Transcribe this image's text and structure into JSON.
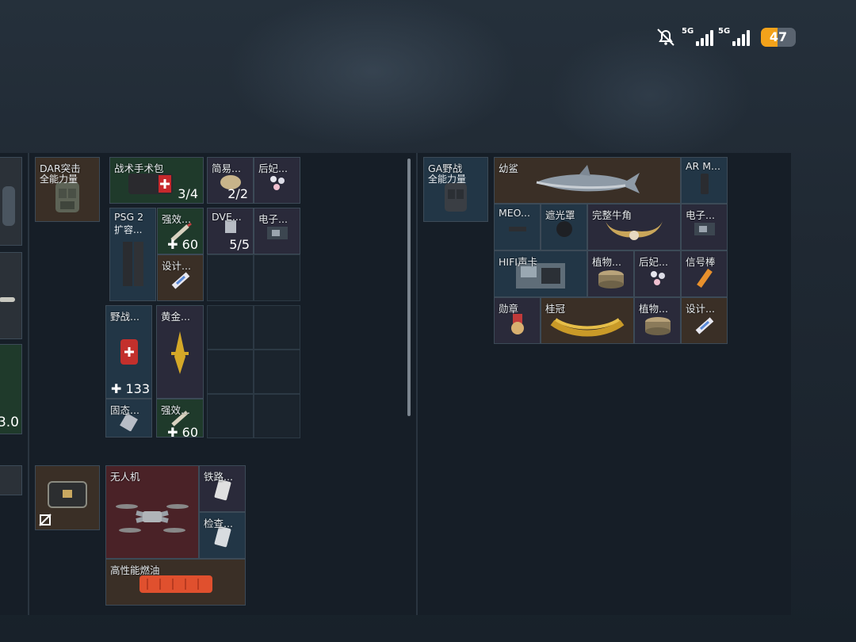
{
  "status_bar": {
    "network_1": "5G",
    "network_2": "5G",
    "battery": "47",
    "battery_level": 0.47
  },
  "left_edge": {
    "value_text": "3.0"
  },
  "backpack": {
    "armor_rig": {
      "name": "DAR突击",
      "sub": "全能力量"
    },
    "items": [
      {
        "id": "surgery_kit",
        "name": "战术手术包",
        "count": "3/4"
      },
      {
        "id": "simple_item",
        "name": "简易...",
        "count": "2/2"
      },
      {
        "id": "queen_1",
        "name": "后妃..."
      },
      {
        "id": "psg2",
        "name": "PSG 2",
        "sub": "扩容..."
      },
      {
        "id": "strong_1",
        "name": "强效...",
        "count": "60"
      },
      {
        "id": "dve",
        "name": "DVE...",
        "count": "5/5"
      },
      {
        "id": "electronic_1",
        "name": "电子..."
      },
      {
        "id": "design_1",
        "name": "设计..."
      },
      {
        "id": "field_kit",
        "name": "野战...",
        "count": "133"
      },
      {
        "id": "gold_item",
        "name": "黄金..."
      },
      {
        "id": "solid",
        "name": "固态..."
      },
      {
        "id": "strong_2",
        "name": "强效...",
        "count": "60"
      }
    ]
  },
  "secure": {
    "items": [
      {
        "id": "drone",
        "name": "无人机"
      },
      {
        "id": "railway",
        "name": "铁路..."
      },
      {
        "id": "inspect",
        "name": "检查..."
      },
      {
        "id": "fuel",
        "name": "高性能燃油"
      }
    ]
  },
  "loot": {
    "armor_rig": {
      "name": "GA野战",
      "sub": "全能力量"
    },
    "items": [
      {
        "id": "shark",
        "name": "幼鲨"
      },
      {
        "id": "ar_mag",
        "name": "AR M..."
      },
      {
        "id": "meo",
        "name": "MEO..."
      },
      {
        "id": "hood",
        "name": "遮光罩"
      },
      {
        "id": "horn",
        "name": "完整牛角"
      },
      {
        "id": "electronic_2",
        "name": "电子..."
      },
      {
        "id": "hifi",
        "name": "HIFI声卡"
      },
      {
        "id": "plant_1",
        "name": "植物..."
      },
      {
        "id": "queen_2",
        "name": "后妃..."
      },
      {
        "id": "flare",
        "name": "信号棒"
      },
      {
        "id": "medal",
        "name": "勋章"
      },
      {
        "id": "laurel",
        "name": "桂冠"
      },
      {
        "id": "plant_2",
        "name": "植物..."
      },
      {
        "id": "design_2",
        "name": "设计..."
      }
    ]
  },
  "colors": {
    "battery": "#f3a21a",
    "rarity_green": "#1f3a2b",
    "rarity_blue": "#223646",
    "rarity_purple": "#2a2a3a",
    "rarity_orange": "#3a2f26",
    "rarity_red": "#4a2227"
  }
}
